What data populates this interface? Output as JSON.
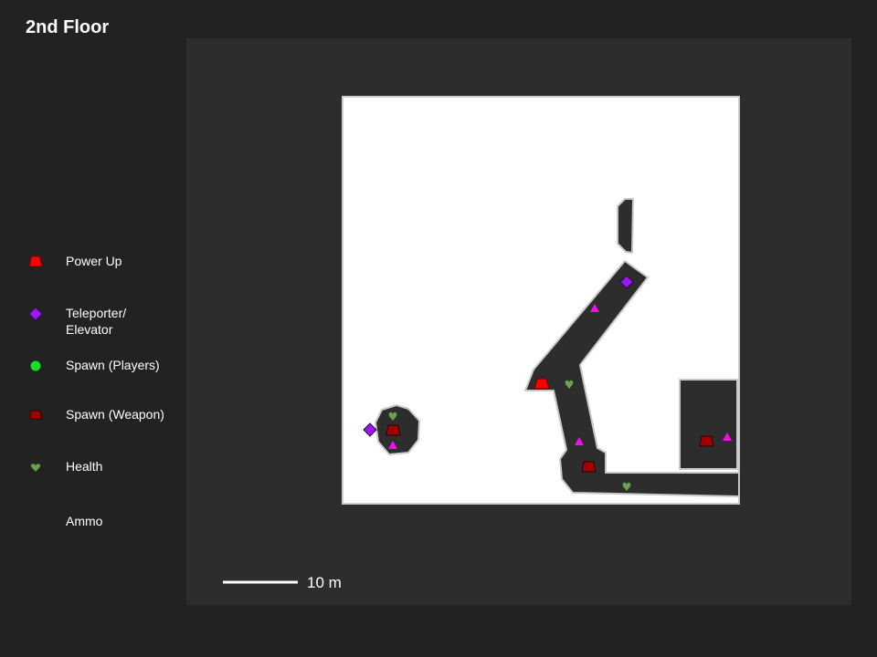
{
  "floor_title": "2nd Floor",
  "legend": {
    "power_up": {
      "label": "Power Up",
      "icon": "power-up-icon",
      "color": "#ff0000"
    },
    "teleporter": {
      "label": "Teleporter/\nElevator",
      "icon": "teleporter-icon",
      "color": "#9b19f0"
    },
    "spawn_players": {
      "label": "Spawn (Players)",
      "icon": "spawn-players-icon",
      "color": "#16e026"
    },
    "spawn_weapon": {
      "label": "Spawn (Weapon)",
      "icon": "spawn-weapon-icon",
      "color": "#a10000"
    },
    "health": {
      "label": "Health",
      "icon": "health-icon",
      "color": "#6ba34a"
    },
    "ammo": {
      "label": "Ammo",
      "icon": "ammo-icon",
      "color": "#ee11ee"
    }
  },
  "scale": {
    "label": "10 m"
  },
  "colors": {
    "background": "#222222",
    "map_panel": "#2d2d2d",
    "floor_area": "#ffffff",
    "walls": "#2d2d2d"
  }
}
